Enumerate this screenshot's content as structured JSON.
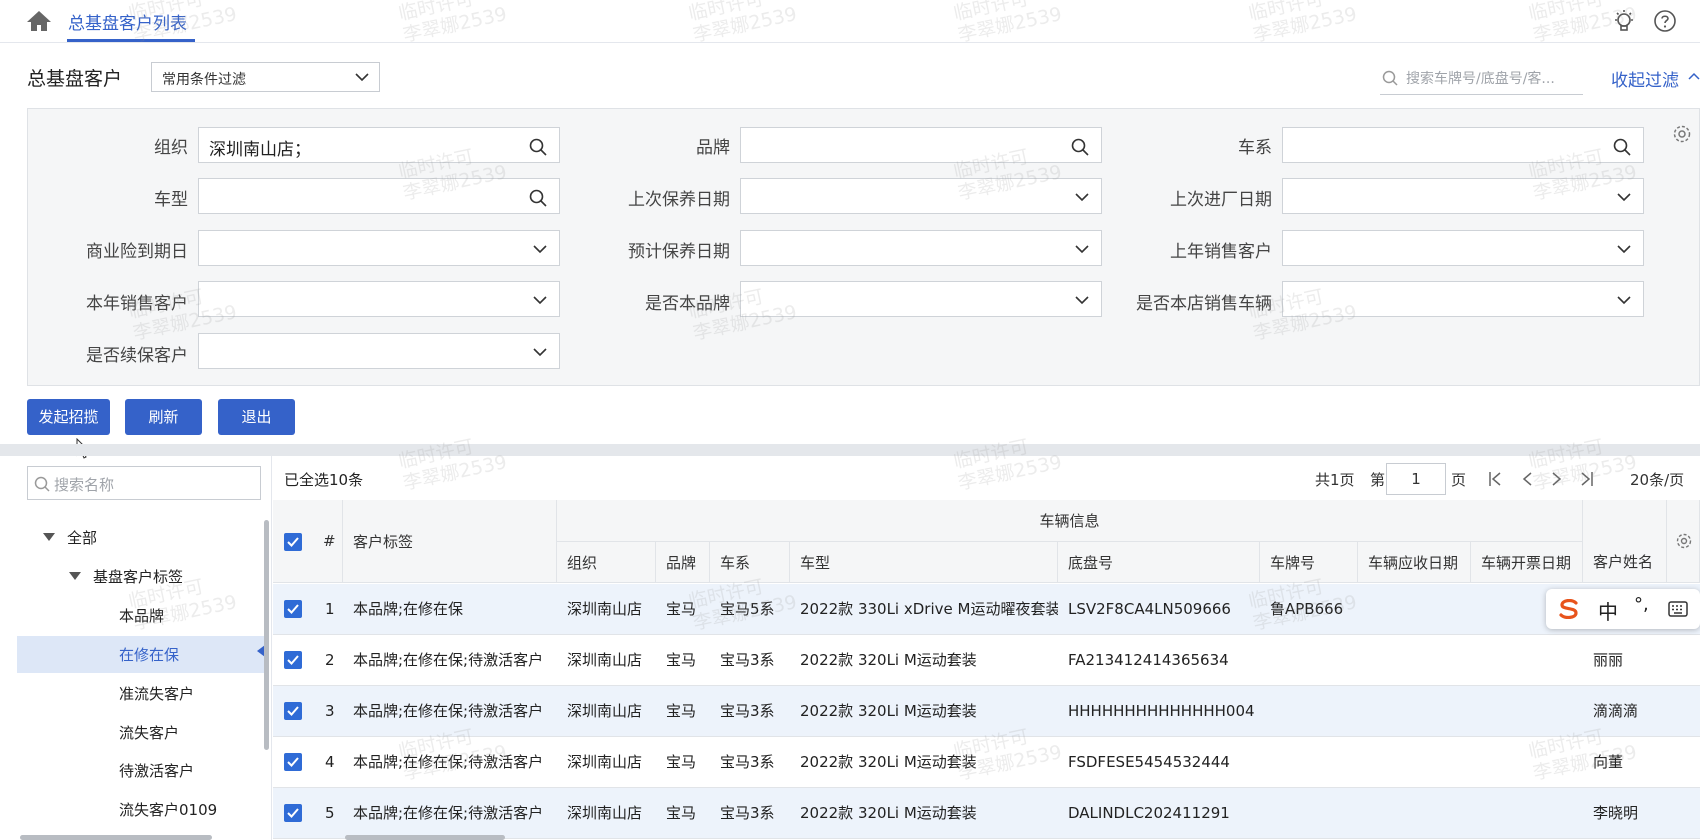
{
  "topbar": {
    "tab_title": "总基盘客户列表"
  },
  "header": {
    "page_title": "总基盘客户",
    "filter_select": "常用条件过滤",
    "search_placeholder": "搜索车牌号/底盘号/客...",
    "collapse_link": "收起过滤"
  },
  "filters": {
    "org_label": "组织",
    "org_value": "深圳南山店；",
    "brand_label": "品牌",
    "series_label": "车系",
    "model_label": "车型",
    "last_maint_label": "上次保养日期",
    "last_visit_label": "上次进厂日期",
    "insurance_label": "商业险到期日",
    "est_maint_label": "预计保养日期",
    "last_year_sales_label": "上年销售客户",
    "this_year_sales_label": "本年销售客户",
    "own_brand_label": "是否本品牌",
    "store_sold_label": "是否本店销售车辆",
    "renew_label": "是否续保客户"
  },
  "actions": {
    "start": "发起招揽",
    "refresh": "刷新",
    "exit": "退出"
  },
  "tree": {
    "search_placeholder": "搜索名称",
    "items": [
      "全部",
      "基盘客户标签",
      "本品牌",
      "在修在保",
      "准流失客户",
      "流失客户",
      "待激活客户",
      "流失客户0109"
    ]
  },
  "table": {
    "selection_info": "已全选10条",
    "pager": {
      "total_pages": "共1页",
      "page_prefix": "第",
      "page_value": "1",
      "page_suffix": "页",
      "page_size": "20条/页"
    },
    "group_header": "车辆信息",
    "headers": {
      "num": "#",
      "tag": "客户标签",
      "org": "组织",
      "brand": "品牌",
      "series": "车系",
      "model": "车型",
      "vin": "底盘号",
      "plate": "车牌号",
      "recv_date": "车辆应收日期",
      "invoice_date": "车辆开票日期",
      "name": "客户姓名"
    },
    "rows": [
      {
        "num": "1",
        "tag": "本品牌;在修在保",
        "org": "深圳南山店",
        "brand": "宝马",
        "series": "宝马5系",
        "model": "2022款 330Li xDrive M运动曜夜套装",
        "vin": "LSV2F8CA4LN509666",
        "plate": "鲁APB666",
        "recv_date": "",
        "invoice_date": "",
        "name": ""
      },
      {
        "num": "2",
        "tag": "本品牌;在修在保;待激活客户",
        "org": "深圳南山店",
        "brand": "宝马",
        "series": "宝马3系",
        "model": "2022款 320Li M运动套装",
        "vin": "FA213412414365634",
        "plate": "",
        "recv_date": "",
        "invoice_date": "",
        "name": "丽丽"
      },
      {
        "num": "3",
        "tag": "本品牌;在修在保;待激活客户",
        "org": "深圳南山店",
        "brand": "宝马",
        "series": "宝马3系",
        "model": "2022款 320Li M运动套装",
        "vin": "HHHHHHHHHHHHHH004",
        "plate": "",
        "recv_date": "",
        "invoice_date": "",
        "name": "滴滴滴"
      },
      {
        "num": "4",
        "tag": "本品牌;在修在保;待激活客户",
        "org": "深圳南山店",
        "brand": "宝马",
        "series": "宝马3系",
        "model": "2022款 320Li M运动套装",
        "vin": "FSDFESE5454532444",
        "plate": "",
        "recv_date": "",
        "invoice_date": "",
        "name": "向董"
      },
      {
        "num": "5",
        "tag": "本品牌;在修在保;待激活客户",
        "org": "深圳南山店",
        "brand": "宝马",
        "series": "宝马3系",
        "model": "2022款 320Li M运动套装",
        "vin": "DALINDLC202411291",
        "plate": "",
        "recv_date": "",
        "invoice_date": "",
        "name": "李晓明"
      }
    ]
  },
  "ime": {
    "lang": "中",
    "punct": "°,"
  },
  "watermark": {
    "line1": "临时许可",
    "line2": "李翠娜2539"
  },
  "colors": {
    "primary": "#3562c9",
    "checkbox": "#2f6bd6",
    "row_alt": "#edf3fb",
    "panel_bg": "#f5f6f7"
  }
}
